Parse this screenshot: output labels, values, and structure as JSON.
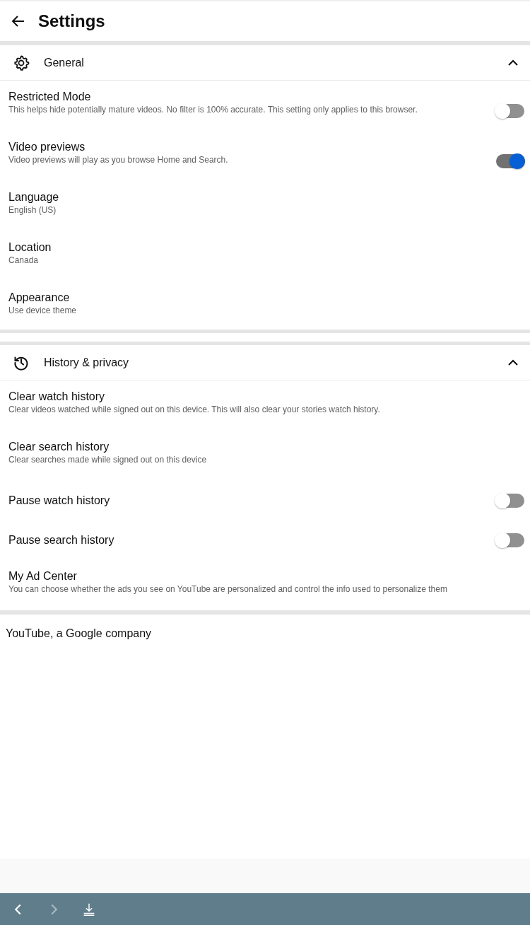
{
  "header": {
    "title": "Settings"
  },
  "sections": [
    {
      "title": "General",
      "expanded": true,
      "rows": [
        {
          "kind": "toggle",
          "title": "Restricted Mode",
          "subtitle": "This helps hide potentially mature videos. No filter is 100% accurate. This setting only applies to this browser.",
          "on": false
        },
        {
          "kind": "toggle",
          "title": "Video previews",
          "subtitle": "Video previews will play as you browse Home and Search.",
          "on": true
        },
        {
          "kind": "link",
          "title": "Language",
          "subtitle": "English (US)"
        },
        {
          "kind": "link",
          "title": "Location",
          "subtitle": "Canada"
        },
        {
          "kind": "link",
          "title": "Appearance",
          "subtitle": "Use device theme"
        }
      ]
    },
    {
      "title": "History & privacy",
      "expanded": true,
      "rows": [
        {
          "kind": "link",
          "title": "Clear watch history",
          "subtitle": "Clear videos watched while signed out on this device. This will also clear your stories watch history."
        },
        {
          "kind": "link",
          "title": "Clear search history",
          "subtitle": "Clear searches made while signed out on this device"
        },
        {
          "kind": "toggle",
          "title": "Pause watch history",
          "on": false
        },
        {
          "kind": "toggle",
          "title": "Pause search history",
          "on": false
        },
        {
          "kind": "link",
          "title": "My Ad Center",
          "subtitle": "You can choose whether the ads you see on YouTube are personalized and control the info used to personalize them"
        }
      ]
    }
  ],
  "footer": "YouTube, a Google company",
  "browser_toolbar": [
    {
      "kind": "back",
      "disabled": false
    },
    {
      "kind": "forward",
      "disabled": true
    },
    {
      "kind": "download",
      "disabled": false
    }
  ]
}
